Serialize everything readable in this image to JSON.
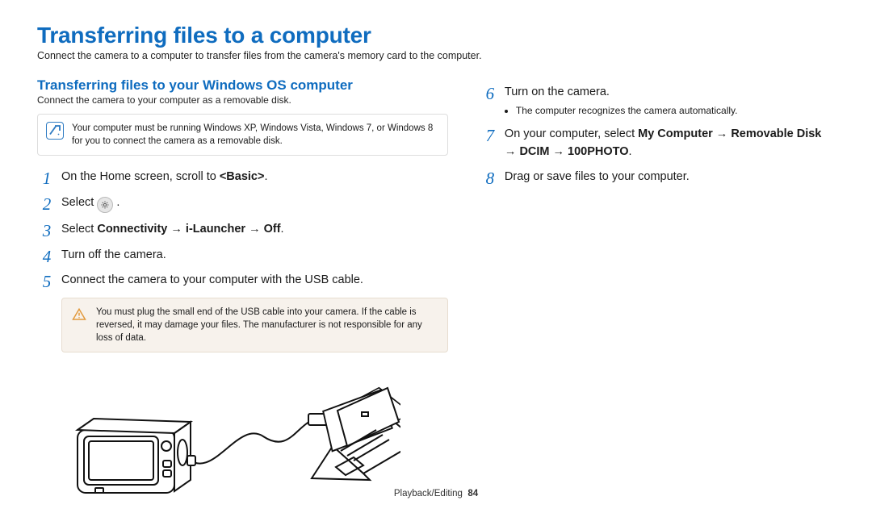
{
  "title": "Transferring files to a computer",
  "intro": "Connect the camera to a computer to transfer files from the camera's memory card to the computer.",
  "section": {
    "heading": "Transferring files to your Windows OS computer",
    "sub": "Connect the camera to your computer as a removable disk."
  },
  "note": "Your computer must be running Windows XP, Windows Vista, Windows 7, or Windows 8 for you to connect the camera as a removable disk.",
  "steps_left": {
    "s1a": "On the Home screen, scroll to ",
    "s1b": "<Basic>",
    "s1c": ".",
    "s2a": "Select ",
    "s2b": " .",
    "s3a": "Select ",
    "s3b": "Connectivity → i-Launcher → Off",
    "s3c": ".",
    "s4": "Turn off the camera.",
    "s5": "Connect the camera to your computer with the USB cable."
  },
  "warn": "You must plug the small end of the USB cable into your camera. If the cable is reversed, it may damage your files. The manufacturer is not responsible for any loss of data.",
  "steps_right": {
    "s6": "Turn on the camera.",
    "s6_sub1": "The computer recognizes the camera automatically.",
    "s7a": "On your computer, select ",
    "s7b": "My Computer → Removable Disk → DCIM → 100PHOTO",
    "s7c": ".",
    "s8": "Drag or save files to your computer."
  },
  "footer": {
    "section": "Playback/Editing",
    "page": "84"
  }
}
